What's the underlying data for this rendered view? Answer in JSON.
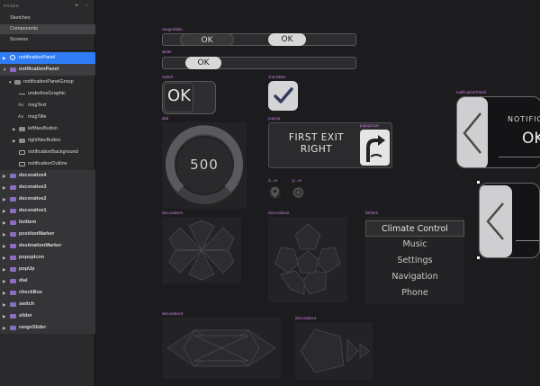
{
  "sidebar": {
    "title": "PAGES",
    "pages": [
      {
        "label": "Sketches"
      },
      {
        "label": "Components"
      },
      {
        "label": "Screens"
      }
    ],
    "layers": [
      {
        "label": "notificationPanel"
      },
      {
        "label": "notificationPanel"
      },
      {
        "label": "notificationPanelGroup"
      },
      {
        "label": "underlineGraphic"
      },
      {
        "label": "msgText"
      },
      {
        "label": "msgTitle"
      },
      {
        "label": "leftNavButton"
      },
      {
        "label": "rightNavButton"
      },
      {
        "label": "notificationBackground"
      },
      {
        "label": "notificationOutline"
      },
      {
        "label": "decorative4"
      },
      {
        "label": "decorative3"
      },
      {
        "label": "decorative2"
      },
      {
        "label": "decorative1"
      },
      {
        "label": "listItem"
      },
      {
        "label": "positionMarker"
      },
      {
        "label": "destinationMarker"
      },
      {
        "label": "popupIcon"
      },
      {
        "label": "popUp"
      },
      {
        "label": "dial"
      },
      {
        "label": "checkBox"
      },
      {
        "label": "switch"
      },
      {
        "label": "slider"
      },
      {
        "label": "rangeSlider"
      }
    ]
  },
  "canvas": {
    "artboards": {
      "range_slider": "rangeSlider",
      "slider": "slider",
      "switch": "switch",
      "checkbox": "checkBox",
      "dial": "dial",
      "popup": "popUp",
      "popup_icon": "popupIcon",
      "notification_panel": "notificationPanel",
      "marker1": "d...er",
      "marker2": "p...er",
      "decorative1": "decorative1",
      "decorative2": "decorative2",
      "list_item": "listItem",
      "decorative3": "decorative3",
      "decorative4": "decorative4"
    },
    "range_slider": {
      "low_label": "OK",
      "high_label": "OK"
    },
    "slider": {
      "label": "OK"
    },
    "switch": {
      "label": "OK"
    },
    "dial": {
      "value": "500"
    },
    "popup": {
      "line1": "FIRST EXIT",
      "line2": "RIGHT"
    },
    "notification": {
      "title": "NOTIFICATI",
      "body": "OK"
    },
    "list_items": [
      {
        "label": "Climate Control"
      },
      {
        "label": "Music"
      },
      {
        "label": "Settings"
      },
      {
        "label": "Navigation"
      },
      {
        "label": "Phone"
      }
    ]
  }
}
